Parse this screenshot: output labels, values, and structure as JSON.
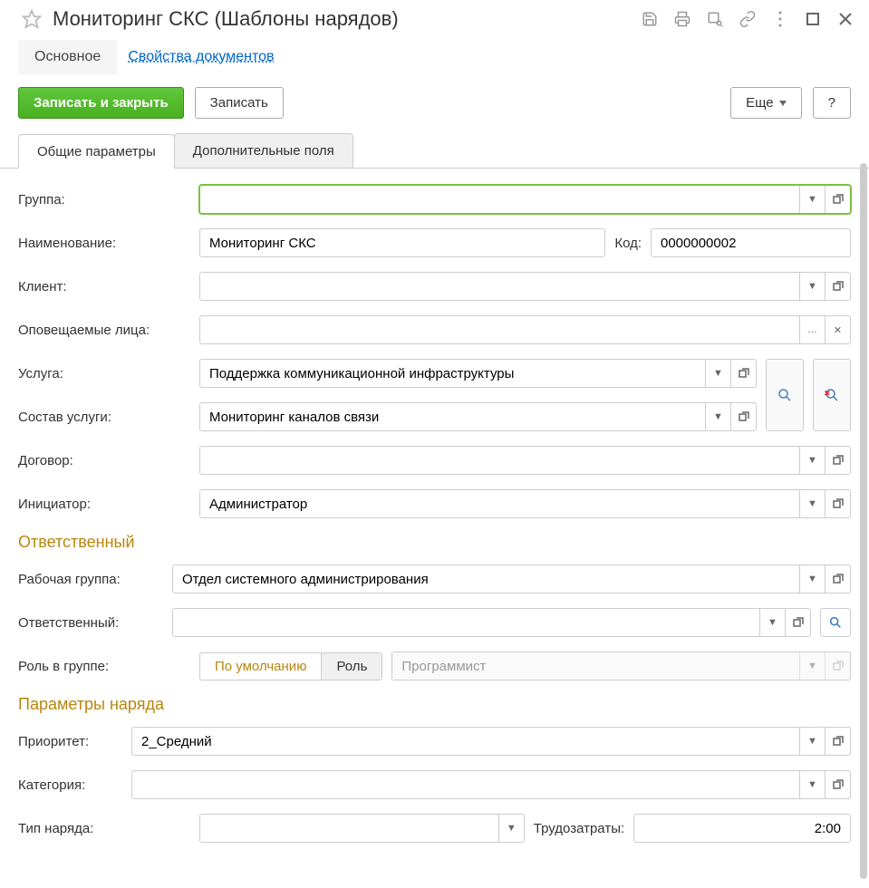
{
  "header": {
    "title": "Мониторинг СКС (Шаблоны нарядов)"
  },
  "nav": {
    "main": "Основное",
    "props": "Свойства документов"
  },
  "toolbar": {
    "save_close": "Записать и закрыть",
    "save": "Записать",
    "more": "Еще",
    "help": "?"
  },
  "subtabs": {
    "general": "Общие параметры",
    "additional": "Дополнительные поля"
  },
  "form": {
    "group_label": "Группа:",
    "group_value": "",
    "name_label": "Наименование:",
    "name_value": "Мониторинг СКС",
    "code_label": "Код:",
    "code_value": "0000000002",
    "client_label": "Клиент:",
    "client_value": "",
    "notified_label": "Оповещаемые лица:",
    "notified_value": "",
    "service_label": "Услуга:",
    "service_value": "Поддержка коммуникационной инфраструктуры",
    "service_comp_label": "Состав услуги:",
    "service_comp_value": "Мониторинг каналов связи",
    "contract_label": "Договор:",
    "contract_value": "",
    "initiator_label": "Инициатор:",
    "initiator_value": "Администратор",
    "responsible_section": "Ответственный",
    "workgroup_label": "Рабочая группа:",
    "workgroup_value": "Отдел системного администрирования",
    "responsible_label": "Ответственный:",
    "responsible_value": "",
    "role_label": "Роль в группе:",
    "role_default": "По умолчанию",
    "role_role": "Роль",
    "role_value": "Программист",
    "order_params_section": "Параметры наряда",
    "priority_label": "Приоритет:",
    "priority_value": "2_Средний",
    "category_label": "Категория:",
    "category_value": "",
    "order_type_label": "Тип наряда:",
    "order_type_value": "",
    "effort_label": "Трудозатраты:",
    "effort_value": "2:00"
  }
}
